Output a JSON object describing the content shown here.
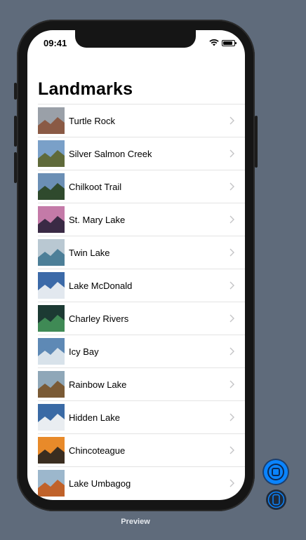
{
  "status": {
    "time": "09:41",
    "battery_level": 0.85
  },
  "page": {
    "title": "Landmarks"
  },
  "landmarks": [
    {
      "name": "Turtle Rock",
      "sky": "#9aa0a8",
      "ground": "#8a5a45"
    },
    {
      "name": "Silver Salmon Creek",
      "sky": "#7aa0c8",
      "ground": "#5f6a3a"
    },
    {
      "name": "Chilkoot Trail",
      "sky": "#6b8fb5",
      "ground": "#2f4a2d"
    },
    {
      "name": "St. Mary Lake",
      "sky": "#c47aa8",
      "ground": "#3a2a45"
    },
    {
      "name": "Twin Lake",
      "sky": "#b9c8d2",
      "ground": "#4d7f98"
    },
    {
      "name": "Lake McDonald",
      "sky": "#3c6aa8",
      "ground": "#e2e8ef"
    },
    {
      "name": "Charley Rivers",
      "sky": "#1c3a33",
      "ground": "#3f8a55"
    },
    {
      "name": "Icy Bay",
      "sky": "#5e89b5",
      "ground": "#d8e2ea"
    },
    {
      "name": "Rainbow Lake",
      "sky": "#8fa7b8",
      "ground": "#7a5a35"
    },
    {
      "name": "Hidden Lake",
      "sky": "#3a6aa5",
      "ground": "#e9edf1"
    },
    {
      "name": "Chincoteague",
      "sky": "#e88a2a",
      "ground": "#3a2d20"
    },
    {
      "name": "Lake Umbagog",
      "sky": "#9cb7cc",
      "ground": "#c0622a"
    }
  ],
  "preview": {
    "label": "Preview"
  },
  "colors": {
    "background": "#5f6b7b",
    "accent": "#0a84ff",
    "chevron": "#c4c4c6"
  }
}
